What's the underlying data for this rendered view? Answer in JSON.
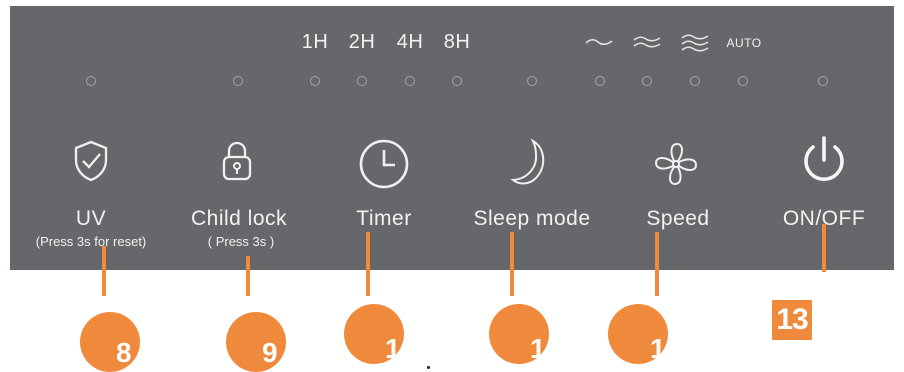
{
  "timer_options": [
    "1H",
    "2H",
    "4H",
    "8H"
  ],
  "speed_options": {
    "icons": [
      "wave-low-icon",
      "wave-medium-icon",
      "wave-high-icon"
    ],
    "auto_label": "AUTO"
  },
  "buttons": [
    {
      "id": "uv",
      "label": "UV",
      "sub": "(Press 3s for reset)",
      "icon": "shield-check-icon"
    },
    {
      "id": "child-lock",
      "label": "Child lock",
      "sub": "( Press 3s )",
      "icon": "padlock-icon"
    },
    {
      "id": "timer",
      "label": "Timer",
      "sub": "",
      "icon": "clock-icon"
    },
    {
      "id": "sleep",
      "label": "Sleep mode",
      "sub": "",
      "icon": "moon-icon"
    },
    {
      "id": "speed",
      "label": "Speed",
      "sub": "",
      "icon": "fan-icon"
    },
    {
      "id": "power",
      "label": "ON/OFF",
      "sub": "",
      "icon": "power-icon"
    }
  ],
  "callouts": [
    "8",
    "9",
    "1",
    "1",
    "1",
    "13"
  ],
  "colors": {
    "panel": "#66676b",
    "callout": "#ef8a3c",
    "text": "#f2f2f2"
  }
}
